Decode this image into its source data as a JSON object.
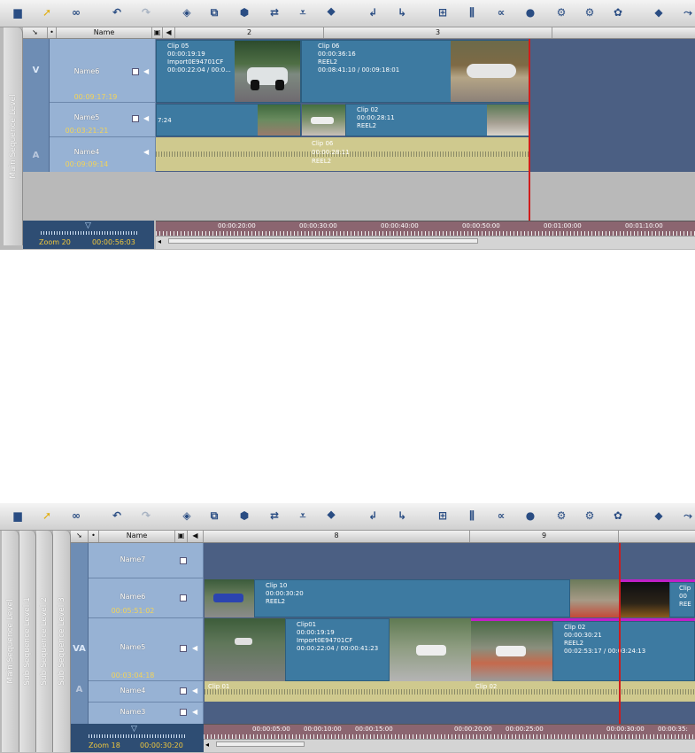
{
  "top": {
    "level_label": "Main Sequence Level",
    "header": {
      "name_col": "Name",
      "sections": [
        "2",
        "3"
      ]
    },
    "tracks": [
      {
        "tag": "V",
        "name": "Name6",
        "time": "00:09:17:19"
      },
      {
        "tag": "",
        "name": "Name5",
        "time": "00:03:21:21"
      },
      {
        "tag": "A",
        "name": "Name4",
        "time": "00:09:09:14"
      }
    ],
    "clips": {
      "clip05": {
        "title": "Clip 05",
        "dur": "00:00:19:19",
        "reel": "Import0E94701CF",
        "range": "00:00:22:04 / 00:0..."
      },
      "clip06": {
        "title": "Clip 06",
        "dur": "00:00:36:16",
        "reel": "REEL2",
        "range": "00:08:41:10 / 00:09:18:01"
      },
      "clip02": {
        "title": "Clip 02",
        "dur": "00:00:28:11",
        "reel": "REEL2"
      },
      "fragment": "7:24",
      "audio06": {
        "title": "Clip 06",
        "dur": "00:00:28:11",
        "reel": "REEL2"
      }
    },
    "ruler": [
      "00:00:20:00",
      "00:00:30:00",
      "00:00:40:00",
      "00:00:50:00",
      "00:01:00:00",
      "00:01:10:00"
    ],
    "zoom": {
      "label": "Zoom 20",
      "time": "00:00:56:03"
    }
  },
  "bottom": {
    "levels": [
      "Main Sequence Level",
      "Sub Sequence Level 1",
      "Sub Sequence Level 2",
      "Sub Sequence Level 3"
    ],
    "header": {
      "name_col": "Name",
      "sections": [
        "8",
        "9"
      ]
    },
    "tracks": [
      {
        "tag": "",
        "name": "Name7",
        "time": ""
      },
      {
        "tag": "",
        "name": "Name6",
        "time": "00:05:51:02"
      },
      {
        "tag": "VA",
        "name": "Name5",
        "time": "00:03:04:18"
      },
      {
        "tag": "A",
        "name": "Name4",
        "time": ""
      },
      {
        "tag": "",
        "name": "Name3",
        "time": ""
      }
    ],
    "clips": {
      "clip10": {
        "title": "Clip 10",
        "dur": "00:00:30:20",
        "reel": "REEL2"
      },
      "clip01": {
        "title": "Clip01",
        "dur": "00:00:19:19",
        "reel": "Import0E94701CF",
        "range": "00:00:22:04 / 00:00:41:23"
      },
      "clip02": {
        "title": "Clip 02",
        "dur": "00:00:30:21",
        "reel": "REEL2",
        "range": "00:02:53:17 / 00:03:24:13"
      },
      "cut_clip": {
        "title": "Clip",
        "dur": "00",
        "reel": "REE"
      },
      "audio01": "Clip 01",
      "audio02": "Clip 02"
    },
    "ruler": [
      "00:00:05:00",
      "00:00:10:00",
      "00:00:15:00",
      "00:00:20:00",
      "00:00:25:00",
      "00:00:30:00",
      "00:00:35:"
    ],
    "zoom": {
      "label": "Zoom 18",
      "time": "00:00:30:20"
    }
  }
}
